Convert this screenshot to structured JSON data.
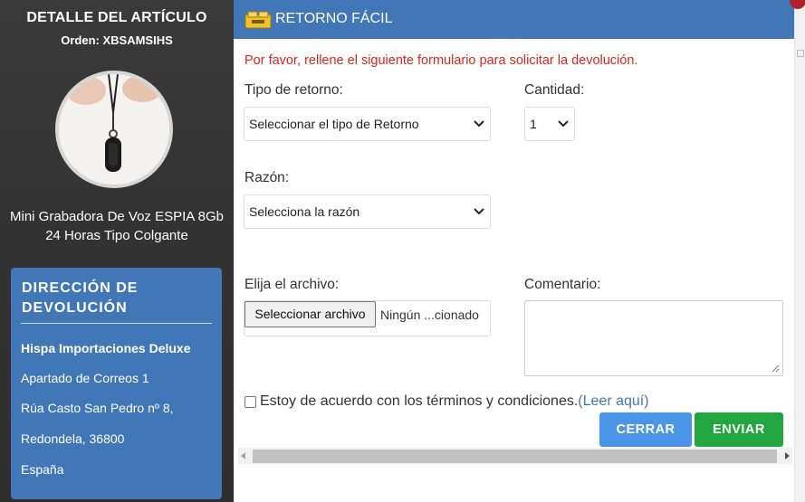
{
  "left": {
    "title": "DETALLE DEL ARTÍCULO",
    "order": "Orden: XBSAMSIHS",
    "product_line1": "Mini Grabadora De Voz ESPIA 8Gb",
    "product_line2": "24 Horas Tipo Colgante",
    "address": {
      "heading_line1": "DIRECCIÓN DE",
      "heading_line2": "DEVOLUCIÓN",
      "company": "Hispa Importaciones Deluxe",
      "line1": "Apartado de Correos 1",
      "line2": "Rúa Casto San Pedro nº 8,",
      "line3": "Redondela, 36800",
      "country": "España"
    }
  },
  "form": {
    "header_title": "RETORNO FÁCIL",
    "notice": "Por favor, rellene el siguiente formulario para solicitar la devolución.",
    "return_type_label": "Tipo de retorno:",
    "return_type_value": "Seleccionar el tipo de Retorno",
    "quantity_label": "Cantidad:",
    "quantity_value": "1",
    "reason_label": "Razón:",
    "reason_value": "Selecciona la razón",
    "file_label": "Elija el archivo:",
    "file_button": "Seleccionar archivo",
    "file_name": "Ningún ...cionado",
    "comment_label": "Comentario:",
    "agree_text": "Estoy de acuerdo con los términos y condiciones.",
    "agree_link": "(Leer aquí)",
    "close_button": "CERRAR",
    "send_button": "ENVIAR"
  },
  "colors": {
    "accent": "#4176b7",
    "notice": "#e0231c",
    "close": "#4a95e8",
    "send": "#22a63f"
  }
}
